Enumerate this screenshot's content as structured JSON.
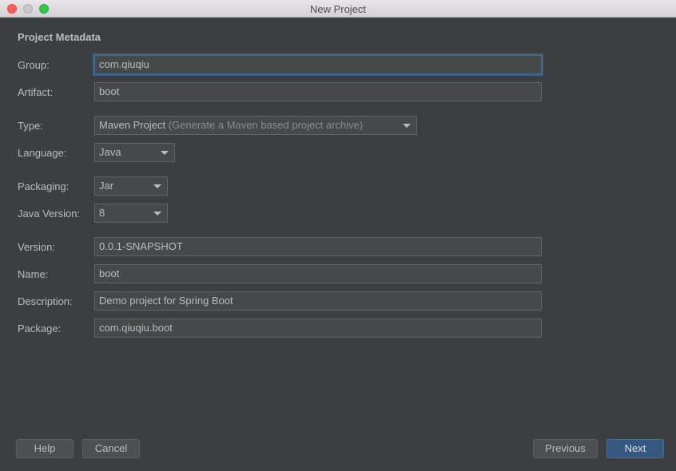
{
  "window": {
    "title": "New Project"
  },
  "section_title": "Project Metadata",
  "fields": {
    "group": {
      "label": "Group:",
      "value": "com.qiuqiu"
    },
    "artifact": {
      "label": "Artifact:",
      "value": "boot"
    },
    "type": {
      "label": "Type:",
      "value": "Maven Project",
      "hint": "(Generate a Maven based project archive)"
    },
    "language": {
      "label": "Language:",
      "value": "Java"
    },
    "packaging": {
      "label": "Packaging:",
      "value": "Jar"
    },
    "java_version": {
      "label": "Java Version:",
      "value": "8"
    },
    "version": {
      "label": "Version:",
      "value": "0.0.1-SNAPSHOT"
    },
    "name": {
      "label": "Name:",
      "value": "boot"
    },
    "description": {
      "label": "Description:",
      "value": "Demo project for Spring Boot"
    },
    "package": {
      "label": "Package:",
      "value": "com.qiuqiu.boot"
    }
  },
  "buttons": {
    "help": "Help",
    "cancel": "Cancel",
    "previous": "Previous",
    "next": "Next"
  },
  "colors": {
    "background": "#3c3f41",
    "field_background": "#45494a",
    "focus_border": "#466d94",
    "primary_button": "#365880",
    "close": "#fc605c",
    "maximize": "#34c84a"
  }
}
